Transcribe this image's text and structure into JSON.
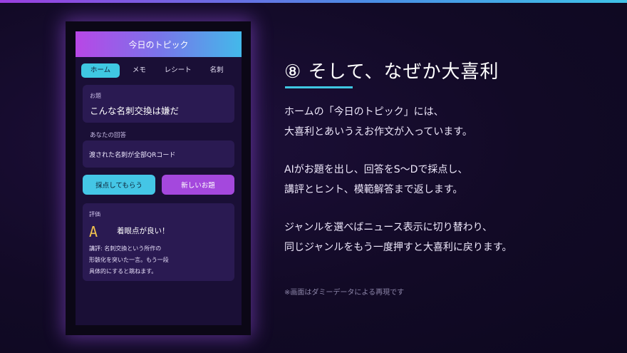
{
  "app": {
    "title": "今日のトピック",
    "tabs": [
      "ホーム",
      "メモ",
      "レシート",
      "名刺"
    ],
    "topic_label": "お題",
    "topic": "こんな名刺交換は嫌だ",
    "answer_label": "あなたの回答",
    "answer": "渡された名刺が全部QRコード",
    "score_button": "採点してもらう",
    "new_topic_button": "新しいお題",
    "evaluation_label": "評価",
    "grade": "A",
    "grade_comment": "着眼点が良い！",
    "review_lines": [
      "講評: 名刺交換という所作の",
      "形骸化を突いた一言。もう一段",
      "具体的にすると跳ねます。"
    ]
  },
  "slide": {
    "heading": "⑧ そして、なぜか大喜利",
    "paragraph1": [
      "ホームの「今日のトピック」には、",
      "大喜利とあいうえお作文が入っています。"
    ],
    "paragraph2": [
      "AIがお題を出し、回答をS〜Dで採点し、",
      "講評とヒント、模範解答まで返します。"
    ],
    "paragraph3": [
      "ジャンルを選べばニュース表示に切り替わり、",
      "同じジャンルをもう一度押すと大喜利に戻ります。"
    ],
    "note": "※画面はダミーデータによる再現です"
  },
  "colors": {
    "accent_cyan": "#3fc7e2",
    "accent_purple": "#a448dd",
    "grade_gold": "#f1c24e",
    "background": "#120a26"
  }
}
